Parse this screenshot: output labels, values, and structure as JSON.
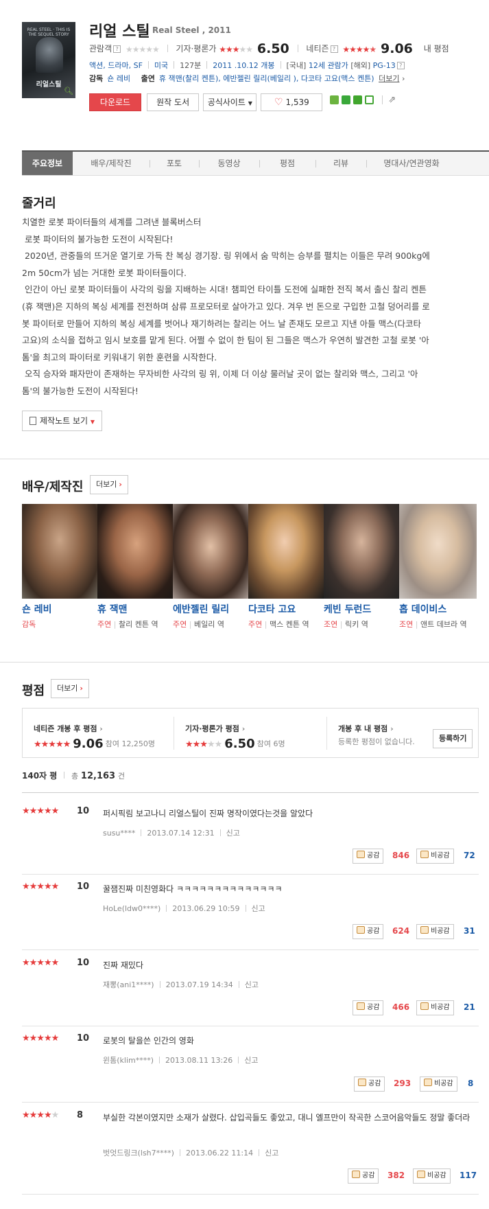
{
  "movie": {
    "poster_caption": "REAL STEEL · THIS IS THE SEQUEL STORY",
    "poster_title": "리얼스틸",
    "title": "리얼 스틸",
    "subtitle": "Real Steel , 2011",
    "audience_label": "관람객",
    "critic_label": "기자·평론가",
    "critic_score": "6.50",
    "netizen_label": "네티즌",
    "netizen_score": "9.06",
    "my_rating_label": "내 평점",
    "genres": "액션, 드라마, SF",
    "country": "미국",
    "runtime": "127분",
    "release": "2011 .10.12 개봉",
    "rating_domestic_prefix": "[국내]",
    "rating_domestic": "12세 관람가",
    "rating_overseas_prefix": "[해외]",
    "rating_overseas": "PG-13",
    "director_label": "감독",
    "director": "숀 레비",
    "cast_label": "출연",
    "cast_line": "휴 잭맨(찰리 켄튼), 에반젤린 릴리(베일리 ), 다코타 고요(맥스 켄튼)",
    "cast_more": "더보기"
  },
  "actions": {
    "download": "다운로드",
    "original_book": "원작 도서",
    "official_site": "공식사이트",
    "like_count": "1,539"
  },
  "tabs": [
    "주요정보",
    "배우/제작진",
    "포토",
    "동영상",
    "평점",
    "리뷰",
    "명대사/연관영화"
  ],
  "synopsis": {
    "title": "줄거리",
    "lines": [
      "치열한 로봇 파이터들의 세계를 그려낸 블록버스터",
      " 로봇 파이터의 불가능한 도전이 시작된다!",
      " 2020년, 관중들의 뜨거운 열기로 가득 찬 복싱 경기장. 링 위에서 숨 막히는 승부를 펼치는 이들은 무려 900kg에",
      "2m 50cm가 넘는 거대한 로봇 파이터들이다.",
      " 인간이 아닌 로봇 파이터들이 사각의 링을 지배하는 시대! 챔피언 타이틀 도전에 실패한 전직 복서 출신 찰리 켄튼",
      "(휴 잭맨)은 지하의 복싱 세계를 전전하며 삼류 프로모터로 살아가고 있다. 겨우 번 돈으로 구입한 고철 덩어리를 로",
      "봇 파이터로 만들어 지하의 복싱 세계를 벗어나 재기하려는 찰리는 어느 날 존재도 모르고 지낸 아들 맥스(다코타",
      "고요)의 소식을 접하고 임시 보호를 맡게 된다. 어쩔 수 없이 한 팀이 된 그들은 맥스가 우연히 발견한 고철 로봇 '아",
      "톰'을 최고의 파이터로 키워내기 위한 훈련을 시작한다.",
      " 오직 승자와 패자만이 존재하는 무자비한 사각의 링 위, 이제 더 이상 물러날 곳이 없는 찰리와 맥스, 그리고 '아",
      "톰'의 불가능한 도전이 시작된다!"
    ],
    "notes_button": "제작노트 보기"
  },
  "cast_section": {
    "title": "배우/제작진",
    "more": "더보기",
    "people": [
      {
        "name": "숀 레비",
        "role": "감독",
        "character": ""
      },
      {
        "name": "휴 잭맨",
        "role": "주연",
        "character": "찰리 켄튼 역"
      },
      {
        "name": "에반젤린 릴리",
        "role": "주연",
        "character": "베일리 역"
      },
      {
        "name": "다코타 고요",
        "role": "주연",
        "character": "맥스 켄튼 역"
      },
      {
        "name": "케빈 두런드",
        "role": "조연",
        "character": "릭키 역"
      },
      {
        "name": "홉 데이비스",
        "role": "조연",
        "character": "앤트 데브라 역"
      }
    ]
  },
  "ratings_section": {
    "title": "평점",
    "more": "더보기",
    "netizen_after_label": "네티즌 개봉 후 평점",
    "netizen_after_score": "9.06",
    "netizen_after_count": "참여 12,250명",
    "critic_label": "기자·평론가 평점",
    "critic_score": "6.50",
    "critic_count": "참여 6명",
    "my_after_label": "개봉 후 내 평점",
    "my_after_empty": "등록한 평점이 없습니다.",
    "register_button": "등록하기",
    "list_label": "140자 평",
    "total_prefix": "총",
    "total_count": "12,163",
    "total_suffix": "건"
  },
  "reviews": [
    {
      "stars": 5,
      "score": "10",
      "text": "퍼시픽림 보고나니 리얼스틸이 진짜 명작이였다는것을 알았다",
      "user": "susu****",
      "date": "2013.07.14 12:31",
      "report": "신고",
      "like_label": "공감",
      "likes": "846",
      "dislike_label": "비공감",
      "dislikes": "72"
    },
    {
      "stars": 5,
      "score": "10",
      "text": "꿀잼진짜 미친영화다 ㅋㅋㅋㅋㅋㅋㅋㅋㅋㅋㅋㅋㅋㅋ",
      "user": "HoLe(ldw0****)",
      "date": "2013.06.29 10:59",
      "report": "신고",
      "like_label": "공감",
      "likes": "624",
      "dislike_label": "비공감",
      "dislikes": "31"
    },
    {
      "stars": 5,
      "score": "10",
      "text": "진짜 재밌다",
      "user": "재뽕(ani1****)",
      "date": "2013.07.19 14:34",
      "report": "신고",
      "like_label": "공감",
      "likes": "466",
      "dislike_label": "비공감",
      "dislikes": "21"
    },
    {
      "stars": 5,
      "score": "10",
      "text": "로봇의 탈을쓴 인간의 영화",
      "user": "윈톰(klim****)",
      "date": "2013.08.11 13:26",
      "report": "신고",
      "like_label": "공감",
      "likes": "293",
      "dislike_label": "비공감",
      "dislikes": "8"
    },
    {
      "stars": 4,
      "score": "8",
      "text": "부실한 각본이였지만 소재가 살렸다. 삽입곡들도 좋았고, 대니 엘프만이 작곡한 스코어음악들도 정말 좋더라",
      "user": "벗엇드링크(lsh7****)",
      "date": "2013.06.22 11:14",
      "report": "신고",
      "like_label": "공감",
      "likes": "382",
      "dislike_label": "비공감",
      "dislikes": "117"
    }
  ],
  "colors": {
    "accent_red": "#e5474b",
    "link_blue": "#1a5aa6",
    "star_red": "#e53b3b"
  }
}
